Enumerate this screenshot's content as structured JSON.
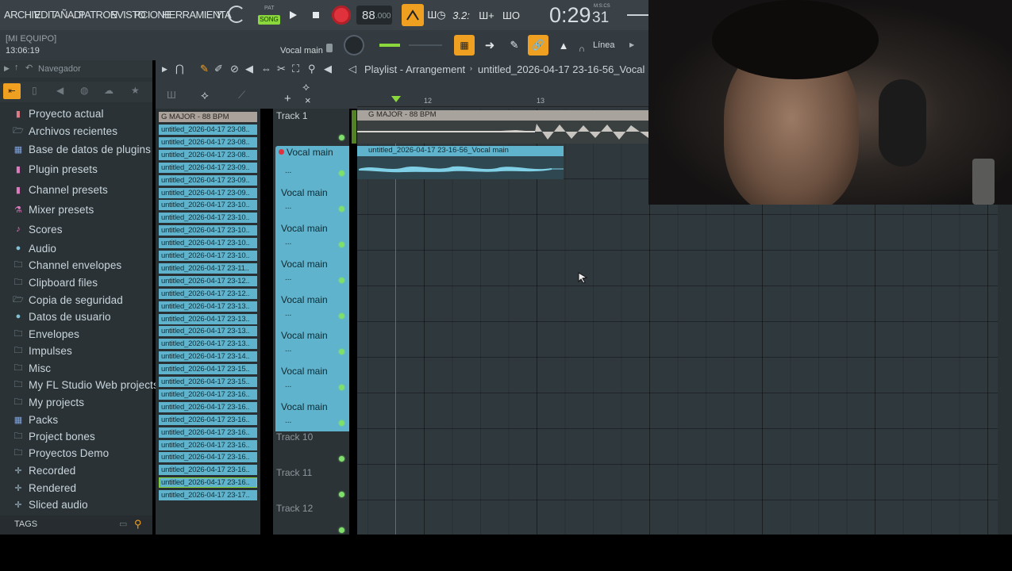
{
  "menu": [
    "ARCHIV",
    "EDIT",
    "AÑADI",
    "PATRON",
    "EVISTO",
    "PCIONE",
    "HERRAMIENTA",
    "Y"
  ],
  "transport": {
    "pat_label": "PAT",
    "song_label": "SONG",
    "tempo": "88",
    "tempo_decimals": ".000",
    "time": "0:29",
    "time_cs": "31",
    "time_unit": "M:S:CS"
  },
  "hint": {
    "line1": "[MI EQUIPO]",
    "line2": "13:06:19"
  },
  "channel": {
    "name": "Vocal main"
  },
  "snap": "Línea",
  "browser": {
    "title": "Navegador",
    "items": [
      {
        "label": "Proyecto actual",
        "icon": "project-icon",
        "color": "#e07a86"
      },
      {
        "label": "Archivos recientes",
        "icon": "recent-folder-icon",
        "color": "#9fb7c2"
      },
      {
        "label": "Base de datos de plugins",
        "icon": "plugin-db-icon",
        "color": "#7fa3e0"
      },
      {
        "label": "Plugin presets",
        "icon": "plugin-preset-icon",
        "color": "#e07ac0"
      },
      {
        "label": "Channel presets",
        "icon": "channel-preset-icon",
        "color": "#e07ac0"
      },
      {
        "label": "Mixer presets",
        "icon": "mixer-preset-icon",
        "color": "#e07ac0"
      },
      {
        "label": "Scores",
        "icon": "note-icon",
        "color": "#e07ac0"
      },
      {
        "label": "Audio",
        "icon": "audio-user-icon",
        "color": "#7fc2d6"
      },
      {
        "label": "Channel envelopes",
        "icon": "folder-icon",
        "color": "#9fb7c2"
      },
      {
        "label": "Clipboard files",
        "icon": "folder-icon",
        "color": "#9fb7c2"
      },
      {
        "label": "Copia de seguridad",
        "icon": "backup-folder-icon",
        "color": "#9fb7c2"
      },
      {
        "label": "Datos de usuario",
        "icon": "user-data-icon",
        "color": "#7fc2d6"
      },
      {
        "label": "Envelopes",
        "icon": "folder-icon",
        "color": "#9fb7c2"
      },
      {
        "label": "Impulses",
        "icon": "folder-icon",
        "color": "#9fb7c2"
      },
      {
        "label": "Misc",
        "icon": "folder-icon",
        "color": "#9fb7c2"
      },
      {
        "label": "My FL Studio Web projects",
        "icon": "folder-icon",
        "color": "#9fb7c2"
      },
      {
        "label": "My projects",
        "icon": "folder-icon",
        "color": "#9fb7c2"
      },
      {
        "label": "Packs",
        "icon": "packs-icon",
        "color": "#7fa3e0"
      },
      {
        "label": "Project bones",
        "icon": "folder-icon",
        "color": "#9fb7c2"
      },
      {
        "label": "Proyectos Demo",
        "icon": "folder-icon",
        "color": "#9fb7c2"
      },
      {
        "label": "Recorded",
        "icon": "recorded-icon",
        "color": "#9fb7c2"
      },
      {
        "label": "Rendered",
        "icon": "rendered-icon",
        "color": "#9fb7c2"
      },
      {
        "label": "Sliced audio",
        "icon": "sliced-audio-icon",
        "color": "#9fb7c2"
      }
    ],
    "tags_label": "TAGS"
  },
  "picker": {
    "header": "G MAJOR - 88 BPM",
    "clips": [
      "untitled_2026-04-17 23-08..",
      "untitled_2026-04-17 23-08..",
      "untitled_2026-04-17 23-08..",
      "untitled_2026-04-17 23-09..",
      "untitled_2026-04-17 23-09..",
      "untitled_2026-04-17 23-09..",
      "untitled_2026-04-17 23-10..",
      "untitled_2026-04-17 23-10..",
      "untitled_2026-04-17 23-10..",
      "untitled_2026-04-17 23-10..",
      "untitled_2026-04-17 23-10..",
      "untitled_2026-04-17 23-11..",
      "untitled_2026-04-17 23-12..",
      "untitled_2026-04-17 23-12..",
      "untitled_2026-04-17 23-13..",
      "untitled_2026-04-17 23-13..",
      "untitled_2026-04-17 23-13..",
      "untitled_2026-04-17 23-13..",
      "untitled_2026-04-17 23-14..",
      "untitled_2026-04-17 23-15..",
      "untitled_2026-04-17 23-15..",
      "untitled_2026-04-17 23-16..",
      "untitled_2026-04-17 23-16..",
      "untitled_2026-04-17 23-16..",
      "untitled_2026-04-17 23-16..",
      "untitled_2026-04-17 23-16..",
      "untitled_2026-04-17 23-16..",
      "untitled_2026-04-17 23-16..",
      "untitled_2026-04-17 23-16..",
      "untitled_2026-04-17 23-17.."
    ]
  },
  "playlist": {
    "title": "Playlist - Arrangement",
    "subtitle": "untitled_2026-04-17 23-16-56_Vocal",
    "bar_12": "12",
    "bar_13": "13",
    "track1": "Track 1",
    "track1_clip": "G MAJOR - 88 BPM",
    "vocal_clip": "untitled_2026-04-17 23-16-56_Vocal main",
    "vocal_tracks": [
      "Vocal main",
      "Vocal main",
      "Vocal main",
      "Vocal main",
      "Vocal main",
      "Vocal main",
      "Vocal main",
      "Vocal main"
    ],
    "dots": "...",
    "track10": "Track 10",
    "track11": "Track 11",
    "track12": "Track 12"
  },
  "colors": {
    "accent_orange": "#f0a020",
    "clip_blue": "#5fb3cc",
    "record_red": "#e0323c",
    "led_green": "#7ee06a"
  }
}
